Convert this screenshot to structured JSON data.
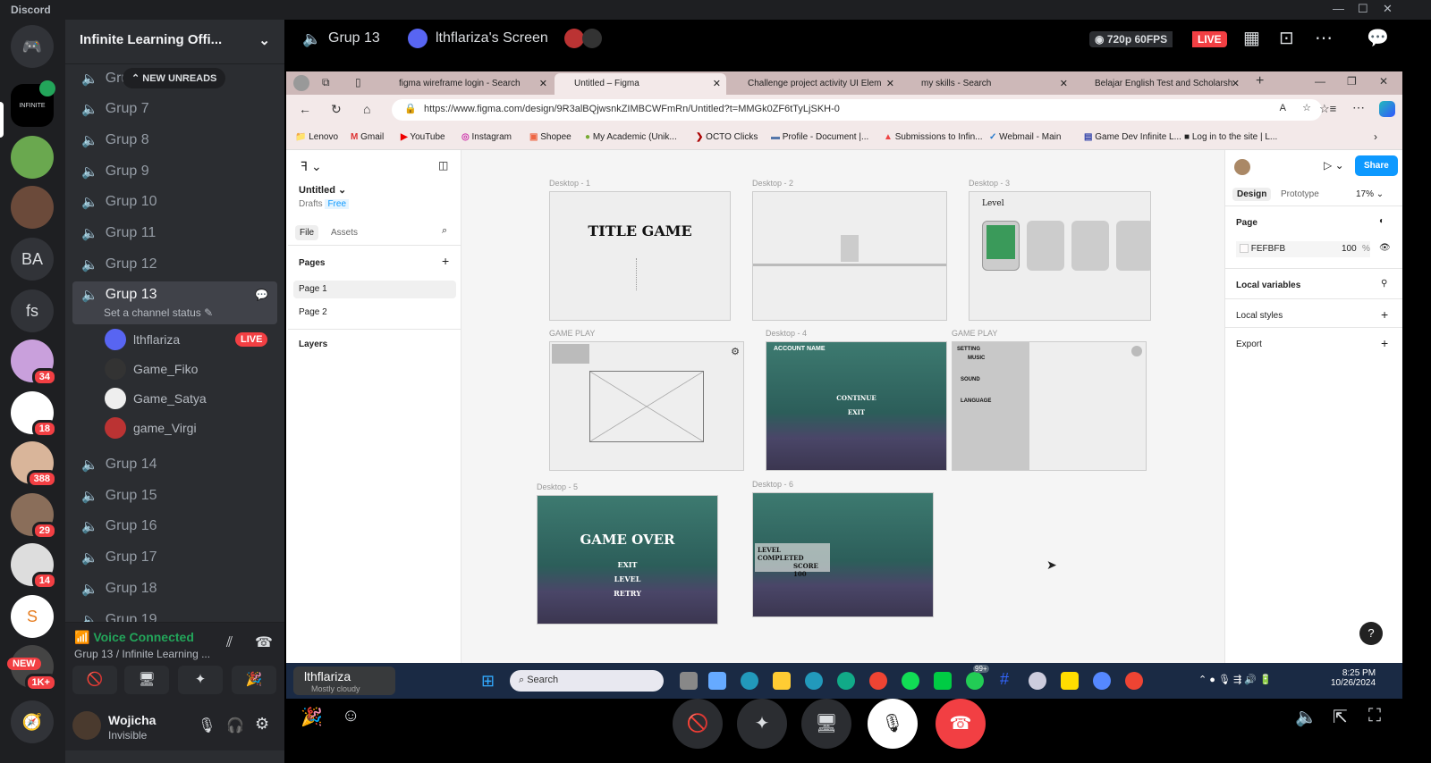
{
  "app": {
    "title": "Discord"
  },
  "server_rail": {
    "servers": [
      {
        "label": "",
        "name": "discord-home"
      },
      {
        "label": "INFINITE",
        "name": "infinite-learning"
      },
      {
        "label": "",
        "name": "server-avatar-1"
      },
      {
        "label": "",
        "name": "server-avatar-2"
      },
      {
        "label": "BA",
        "name": "server-ba"
      },
      {
        "label": "fs",
        "name": "server-fs"
      },
      {
        "label": "",
        "name": "server-3",
        "badge": "34"
      },
      {
        "label": "",
        "name": "server-4",
        "badge": "18"
      },
      {
        "label": "",
        "name": "server-5",
        "badge": "388"
      },
      {
        "label": "",
        "name": "server-6",
        "badge": "29"
      },
      {
        "label": "",
        "name": "server-7",
        "badge": "14"
      },
      {
        "label": "",
        "name": "server-8"
      },
      {
        "label": "",
        "name": "server-9",
        "badge": "1K+",
        "new": "NEW"
      }
    ]
  },
  "channels": {
    "server_name": "Infinite Learning Offi...",
    "new_unreads": "NEW UNREADS",
    "list": [
      "Grup 6",
      "Grup 7",
      "Grup 8",
      "Grup 9",
      "Grup 10",
      "Grup 11",
      "Grup 12"
    ],
    "active": {
      "name": "Grup 13",
      "status": "Set a channel status"
    },
    "users": [
      {
        "name": "lthflariza",
        "live": "LIVE"
      },
      {
        "name": "Game_Fiko"
      },
      {
        "name": "Game_Satya"
      },
      {
        "name": "game_Virgi"
      }
    ],
    "list2": [
      "Grup 14",
      "Grup 15",
      "Grup 16",
      "Grup 17",
      "Grup 18",
      "Grup 19"
    ]
  },
  "voice": {
    "status": "Voice Connected",
    "location": "Grup 13 / Infinite Learning ..."
  },
  "user": {
    "name": "Wojicha",
    "status": "Invisible"
  },
  "stream_header": {
    "channel": "Grup 13",
    "streamer": "lthflariza's Screen",
    "quality": "720p 60FPS",
    "live": "LIVE"
  },
  "browser": {
    "tabs": [
      {
        "label": "figma wireframe login - Search"
      },
      {
        "label": "Untitled – Figma"
      },
      {
        "label": "Challenge project activity UI Elem"
      },
      {
        "label": "my skills - Search"
      },
      {
        "label": "Belajar English Test and Scholarsh"
      }
    ],
    "url": "https://www.figma.com/design/9R3alBQjwsnkZIMBCWFmRn/Untitled?t=MMGk0ZF6tTyLjSKH-0",
    "bookmarks": [
      "Lenovo",
      "Gmail",
      "YouTube",
      "Instagram",
      "Shopee",
      "My Academic (Unik...",
      "OCTO Clicks",
      "Profile - Document |...",
      "Submissions to Infin...",
      "Webmail - Main",
      "Game Dev Infinite L...",
      "Log in to the site | L..."
    ]
  },
  "figma": {
    "file": "Untitled",
    "drafts": "Drafts",
    "plan": "Free",
    "tab_file": "File",
    "tab_assets": "Assets",
    "pages_label": "Pages",
    "pages": [
      "Page 1",
      "Page 2"
    ],
    "layers": "Layers",
    "share": "Share",
    "design": "Design",
    "prototype": "Prototype",
    "zoom": "17%",
    "page_section": "Page",
    "page_color": "FEFBFB",
    "page_opacity": "100",
    "percent": "%",
    "local_variables": "Local variables",
    "local_styles": "Local styles",
    "export": "Export",
    "frames": {
      "d1": "Desktop - 1",
      "d2": "Desktop - 2",
      "d3": "Desktop - 3",
      "gp1": "GAME PLAY",
      "d4": "Desktop - 4",
      "gp2": "GAME PLAY",
      "d5": "Desktop - 5",
      "d6": "Desktop - 6"
    },
    "title_game": "TITLE GAME",
    "level": "Level",
    "account": "ACCOUNT NAME",
    "continue": "CONTINUE",
    "exit": "EXIT",
    "setting": "SETTING",
    "music": "MUSIC",
    "sound": "SOUND",
    "language": "LANGUAGE",
    "game_over": "GAME OVER",
    "go_items": [
      "EXIT",
      "LEVEL",
      "RETRY"
    ],
    "level_completed": "LEVEL COMPLETED",
    "score": "SCORE 100",
    "help": "?"
  },
  "taskbar": {
    "search": "Search",
    "time": "8:25 PM",
    "date": "10/26/2024",
    "weather": "Mostly cloudy",
    "badge": "99+"
  },
  "stream_overlay": {
    "name": "lthflariza"
  }
}
